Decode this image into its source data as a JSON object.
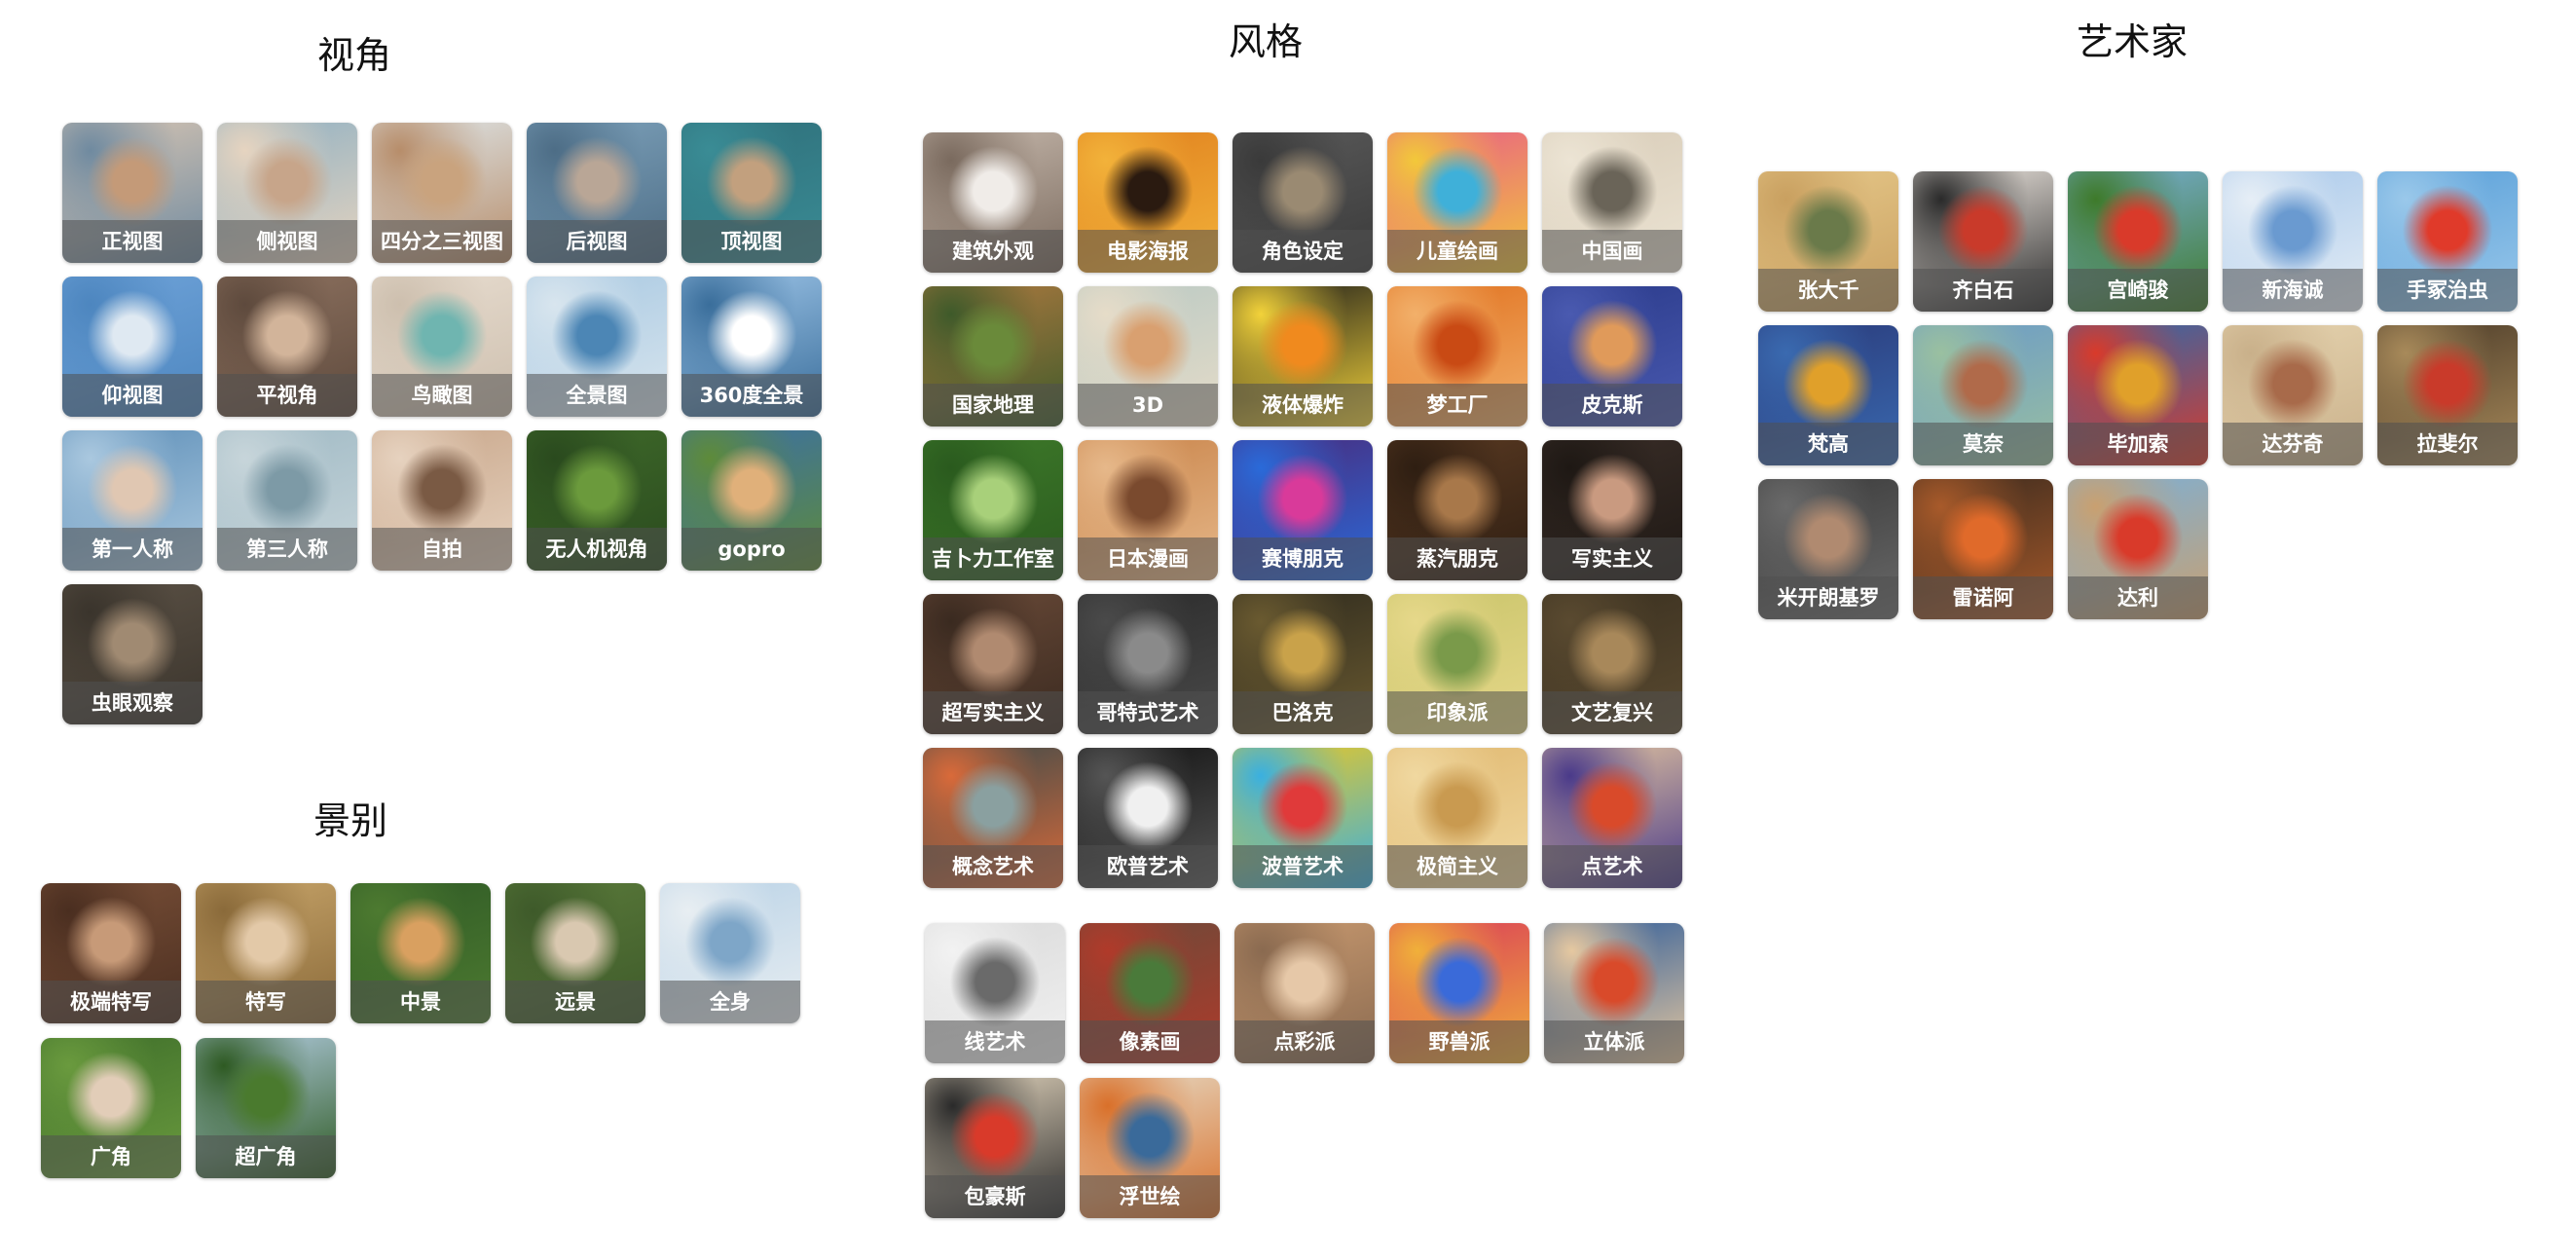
{
  "sections": [
    {
      "id": "angle",
      "title": "视角",
      "items": [
        {
          "label": "正视图",
          "colors": [
            "#d9c6b3",
            "#c49a78",
            "#6f8aa0"
          ]
        },
        {
          "label": "侧视图",
          "colors": [
            "#8fb0c2",
            "#c7a58a",
            "#e6d4c0"
          ]
        },
        {
          "label": "四分之三视图",
          "colors": [
            "#dfe7ea",
            "#c9a37e",
            "#b78d6a"
          ]
        },
        {
          "label": "后视图",
          "colors": [
            "#7ea2bb",
            "#b9a696",
            "#4d6d86"
          ]
        },
        {
          "label": "顶视图",
          "colors": [
            "#2f6f7a",
            "#c2a07e",
            "#3a8c95"
          ]
        },
        {
          "label": "仰视图",
          "colors": [
            "#6fa3d9",
            "#dfe9f2",
            "#4d86bf"
          ]
        },
        {
          "label": "平视角",
          "colors": [
            "#8e7260",
            "#d2b49a",
            "#5e4a3d"
          ]
        },
        {
          "label": "鸟瞰图",
          "colors": [
            "#e8ddd0",
            "#6fb5b0",
            "#cdbfae"
          ]
        },
        {
          "label": "全景图",
          "colors": [
            "#a9c9e2",
            "#4c86b5",
            "#d8e5ee"
          ]
        },
        {
          "label": "360度全景",
          "colors": [
            "#9ec5e8",
            "#ffffff",
            "#3a6e9b"
          ]
        },
        {
          "label": "第一人称",
          "colors": [
            "#5e8fb8",
            "#e0c7b2",
            "#aac8df"
          ]
        },
        {
          "label": "第三人称",
          "colors": [
            "#9fb9c4",
            "#7d9aa6",
            "#c7d5da"
          ]
        },
        {
          "label": "自拍",
          "colors": [
            "#c8a68a",
            "#7a5a44",
            "#e6d2bf"
          ]
        },
        {
          "label": "无人机视角",
          "colors": [
            "#3f6a2a",
            "#6b9a3c",
            "#2a4a1e"
          ]
        },
        {
          "label": "gopro",
          "colors": [
            "#3a6fa8",
            "#e0b07a",
            "#5e8b3a"
          ]
        },
        {
          "label": "虫眼观察",
          "colors": [
            "#5c5246",
            "#a08a72",
            "#3a342c"
          ]
        }
      ]
    },
    {
      "id": "shot",
      "title": "景别",
      "items": [
        {
          "label": "极端特写",
          "colors": [
            "#7a5038",
            "#c79a78",
            "#4a2e20"
          ]
        },
        {
          "label": "特写",
          "colors": [
            "#c9a66b",
            "#e3c9a8",
            "#8a6a3a"
          ]
        },
        {
          "label": "中景",
          "colors": [
            "#2f5a26",
            "#d9a060",
            "#4d7a30"
          ]
        },
        {
          "label": "远景",
          "colors": [
            "#5a7a3a",
            "#d9c8b0",
            "#3e5a2a"
          ]
        },
        {
          "label": "全身",
          "colors": [
            "#b9d2e6",
            "#7ea6c8",
            "#e8eef2"
          ]
        },
        {
          "label": "广角",
          "colors": [
            "#3e6e2a",
            "#e2cdb8",
            "#6a9a3e"
          ]
        },
        {
          "label": "超广角",
          "colors": [
            "#b6cfe6",
            "#4a7a2e",
            "#2e5a22"
          ]
        }
      ]
    },
    {
      "id": "style",
      "title": "风格",
      "items": [
        {
          "label": "建筑外观",
          "colors": [
            "#c7b9ad",
            "#f0ece8",
            "#7a6a5e"
          ]
        },
        {
          "label": "电影海报",
          "colors": [
            "#e0801e",
            "#2a1a10",
            "#f2b23a"
          ]
        },
        {
          "label": "角色设定",
          "colors": [
            "#5a5a5a",
            "#9a8a72",
            "#3a3a3a"
          ]
        },
        {
          "label": "儿童绘画",
          "colors": [
            "#e85a8a",
            "#3fb0d9",
            "#f2c83a"
          ]
        },
        {
          "label": "中国画",
          "colors": [
            "#d8ccb8",
            "#6a6458",
            "#ece4d4"
          ]
        },
        {
          "label": "国家地理",
          "colors": [
            "#b07a40",
            "#6a8a3a",
            "#3e5a2a"
          ]
        },
        {
          "label": "3D",
          "colors": [
            "#b9c9c4",
            "#d9a070",
            "#e6dcc8"
          ]
        },
        {
          "label": "液体爆炸",
          "colors": [
            "#1a1a1a",
            "#f08a1e",
            "#f2d23a"
          ]
        },
        {
          "label": "梦工厂",
          "colors": [
            "#e0701e",
            "#c94a14",
            "#f2b06a"
          ]
        },
        {
          "label": "皮克斯",
          "colors": [
            "#2a3a8a",
            "#e09a5a",
            "#4a5ab0"
          ]
        },
        {
          "label": "吉卜力工作室",
          "colors": [
            "#3e7a2a",
            "#a8d07a",
            "#2a5a1e"
          ]
        },
        {
          "label": "日本漫画",
          "colors": [
            "#c9844a",
            "#7a4a2e",
            "#e6b88a"
          ]
        },
        {
          "label": "赛博朋克",
          "colors": [
            "#4a2a7a",
            "#d93a9a",
            "#2a6ad9"
          ]
        },
        {
          "label": "蒸汽朋克",
          "colors": [
            "#5a3a22",
            "#a8784a",
            "#2e1e12"
          ]
        },
        {
          "label": "写实主义",
          "colors": [
            "#3a2e28",
            "#c99a80",
            "#1e1814"
          ]
        },
        {
          "label": "超写实主义",
          "colors": [
            "#6a4a38",
            "#b08a70",
            "#3a2a20"
          ]
        },
        {
          "label": "哥特式艺术",
          "colors": [
            "#2a2a2a",
            "#8a8a8a",
            "#4a4a4a"
          ]
        },
        {
          "label": "巴洛克",
          "colors": [
            "#2e2a1e",
            "#c9a24a",
            "#6a5a30"
          ]
        },
        {
          "label": "印象派",
          "colors": [
            "#c9c46a",
            "#7a9a4a",
            "#e6d88a"
          ]
        },
        {
          "label": "文艺复兴",
          "colors": [
            "#3a3020",
            "#a8885a",
            "#5a4a30"
          ]
        },
        {
          "label": "概念艺术",
          "colors": [
            "#3a4a4a",
            "#8aa0a0",
            "#d96a3a"
          ]
        },
        {
          "label": "欧普艺术",
          "colors": [
            "#111111",
            "#f0f0f0",
            "#555555"
          ]
        },
        {
          "label": "波普艺术",
          "colors": [
            "#f0c81e",
            "#e03a3a",
            "#3ab0e0"
          ]
        },
        {
          "label": "极简主义",
          "colors": [
            "#e0b870",
            "#c99a50",
            "#f0d8a0"
          ]
        },
        {
          "label": "点艺术",
          "colors": [
            "#e6c8a0",
            "#d94a2a",
            "#4a3a8a"
          ]
        },
        {
          "label": "线艺术",
          "colors": [
            "#d9d9d9",
            "#6a6a6a",
            "#f2f2f2"
          ]
        },
        {
          "label": "像素画",
          "colors": [
            "#6a4a3a",
            "#4a7a3a",
            "#b03a2a"
          ]
        },
        {
          "label": "点彩派",
          "colors": [
            "#c99a70",
            "#e6c8a8",
            "#8a6a50"
          ]
        },
        {
          "label": "野兽派",
          "colors": [
            "#d93a5a",
            "#3a6ad9",
            "#f0b03a"
          ]
        },
        {
          "label": "立体派",
          "colors": [
            "#2a5a9a",
            "#d94a2a",
            "#e6c8a0"
          ]
        },
        {
          "label": "包豪斯",
          "colors": [
            "#e6d8c0",
            "#d93a2a",
            "#2a2a2a"
          ]
        },
        {
          "label": "浮世绘",
          "colors": [
            "#e6dcc8",
            "#3a6a9a",
            "#d9702a"
          ]
        }
      ]
    },
    {
      "id": "artist",
      "title": "艺术家",
      "items": [
        {
          "label": "张大千",
          "colors": [
            "#e6c88a",
            "#6a7a4a",
            "#c9a060"
          ]
        },
        {
          "label": "齐白石",
          "colors": [
            "#f2ebe4",
            "#c93a2a",
            "#2a2a2a"
          ]
        },
        {
          "label": "宫崎骏",
          "colors": [
            "#7ab0d9",
            "#d93a2a",
            "#3e7a2a"
          ]
        },
        {
          "label": "新海诚",
          "colors": [
            "#a8c8ea",
            "#6a9ad0",
            "#e6eef6"
          ]
        },
        {
          "label": "手冢治虫",
          "colors": [
            "#5aa0d9",
            "#e03a2a",
            "#9ac8ea"
          ]
        },
        {
          "label": "梵高",
          "colors": [
            "#2a3a7a",
            "#e0a02a",
            "#3a6ab0"
          ]
        },
        {
          "label": "莫奈",
          "colors": [
            "#6a9ac8",
            "#b06a4a",
            "#9ac0a0"
          ]
        },
        {
          "label": "毕加索",
          "colors": [
            "#2a6ab0",
            "#e0a02a",
            "#d93a2a"
          ]
        },
        {
          "label": "达芬奇",
          "colors": [
            "#e6d4b0",
            "#a86a4a",
            "#c9b08a"
          ]
        },
        {
          "label": "拉斐尔",
          "colors": [
            "#4a3a28",
            "#c93a2a",
            "#a88a5a"
          ]
        },
        {
          "label": "米开朗基罗",
          "colors": [
            "#3a3a3a",
            "#b08a70",
            "#6a6a6a"
          ]
        },
        {
          "label": "雷诺阿",
          "colors": [
            "#3a2a1e",
            "#e06a2a",
            "#a85a2a"
          ]
        },
        {
          "label": "达利",
          "colors": [
            "#7ab0d9",
            "#d93a2a",
            "#c9a070"
          ]
        }
      ]
    }
  ]
}
